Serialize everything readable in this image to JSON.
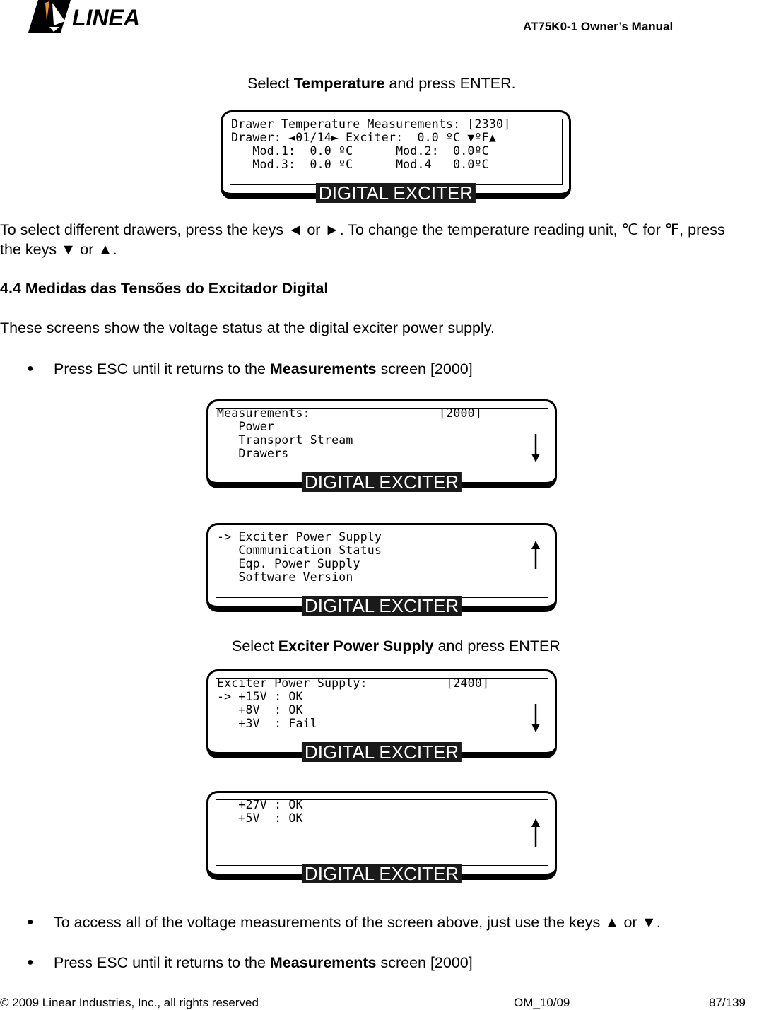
{
  "header": {
    "logo_text": "LINEAR",
    "title": "AT75K0-1 Owner’s Manual"
  },
  "intro": {
    "pre": "Select ",
    "bold": "Temperature",
    "post": " and press ENTER."
  },
  "lcd_label": "DIGITAL EXCITER",
  "lcd1": {
    "lines": [
      "Drawer Temperature Measurements: [2330]",
      "Drawer: ◄01/14► Exciter:  0.0 ºC ▼ºF▲",
      "   Mod.1:  0.0 ºC      Mod.2:  0.0ºC",
      "   Mod.3:  0.0 ºC      Mod.4   0.0ºC"
    ]
  },
  "para1": {
    "line1": "To select different drawers, press the keys ◄ or ►. To change the temperature reading unit, ℃ for ℉, press",
    "line2": "the keys ▼ or ▲."
  },
  "section": {
    "title": "4.4 Medidas das Tensões do Excitador Digital"
  },
  "para2": "These screens show the voltage status at the digital exciter power supply.",
  "bullet1": {
    "pre": "Press ESC until it returns to the ",
    "bold": "Measurements",
    "post": " screen [2000]"
  },
  "lcd2": {
    "lines": [
      "Measurements:                  [2000]",
      "   Power",
      "   Transport Stream",
      "   Drawers"
    ],
    "arrow": "down"
  },
  "lcd3": {
    "lines": [
      "-> Exciter Power Supply",
      "   Communication Status",
      "   Eqp. Power Supply",
      "   Software Version"
    ],
    "arrow": "up"
  },
  "select2": {
    "pre": "Select ",
    "bold": "Exciter Power Supply",
    "post": " and press ENTER"
  },
  "lcd4": {
    "lines": [
      "Exciter Power Supply:           [2400]",
      "-> +15V : OK",
      "   +8V  : OK",
      "   +3V  : Fail"
    ],
    "arrow": "down"
  },
  "lcd5": {
    "lines": [
      "   +27V : OK",
      "   +5V  : OK",
      "",
      ""
    ],
    "arrow": "up"
  },
  "bullet2": "To access all of the voltage measurements of the screen above, just use the keys  ▲ or ▼.",
  "bullet3": {
    "pre": "Press ESC until it returns to the ",
    "bold": "Measurements",
    "post": " screen [2000]"
  },
  "footer": {
    "copyright": "© 2009 Linear Industries, Inc., all rights reserved",
    "doc": "OM_10/09",
    "page": "87/139"
  },
  "colors": {
    "logo_orange": "#e8921f"
  }
}
